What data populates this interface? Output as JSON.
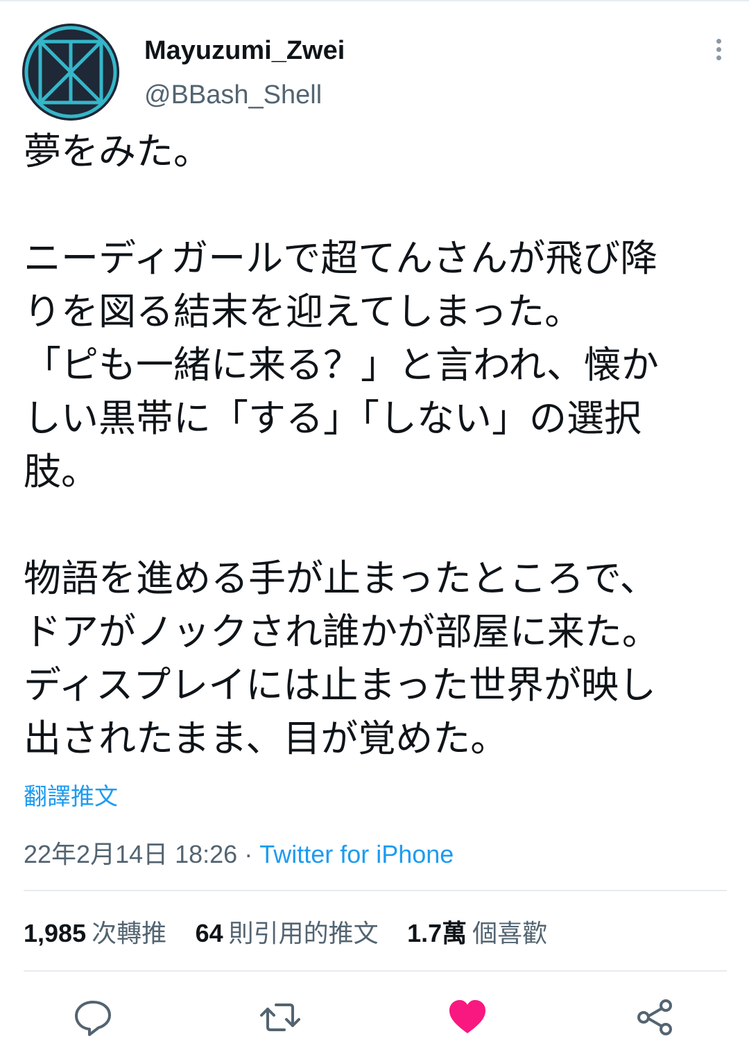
{
  "user": {
    "display_name": "Mayuzumi_Zwei",
    "handle": "@BBash_Shell",
    "avatar_icon": "avatar-emblem-icon"
  },
  "tweet": {
    "paragraphs": [
      [
        "夢をみた。"
      ],
      [
        "ニーディガールで超てんさんが飛び降",
        "りを図る結末を迎えてしまった。",
        "「ピも一緒に来る？」と言われ、懐か",
        "しい黒帯に「する」「しない」の選択",
        "肢。"
      ],
      [
        "物語を進める手が止まったところで、",
        "ドアがノックされ誰かが部屋に来た。",
        "ディスプレイには止まった世界が映し",
        "出されたまま、目が覚めた。"
      ]
    ],
    "translate_label": "翻譯推文",
    "timestamp": "22年2月14日 18:26",
    "separator": " · ",
    "source": "Twitter for iPhone"
  },
  "stats": {
    "retweets": {
      "count": "1,985",
      "label": "次轉推"
    },
    "quotes": {
      "count": "64",
      "label": "則引用的推文"
    },
    "likes": {
      "count": "1.7萬",
      "label": "個喜歡"
    }
  },
  "actions": {
    "reply_icon": "reply-icon",
    "retweet_icon": "retweet-icon",
    "like_icon": "heart-icon",
    "share_icon": "share-icon"
  },
  "colors": {
    "link": "#1d9bf0",
    "muted": "#536471",
    "like": "#f91880",
    "avatar_bg": "#1e2836",
    "avatar_accent": "#35b6c9"
  }
}
